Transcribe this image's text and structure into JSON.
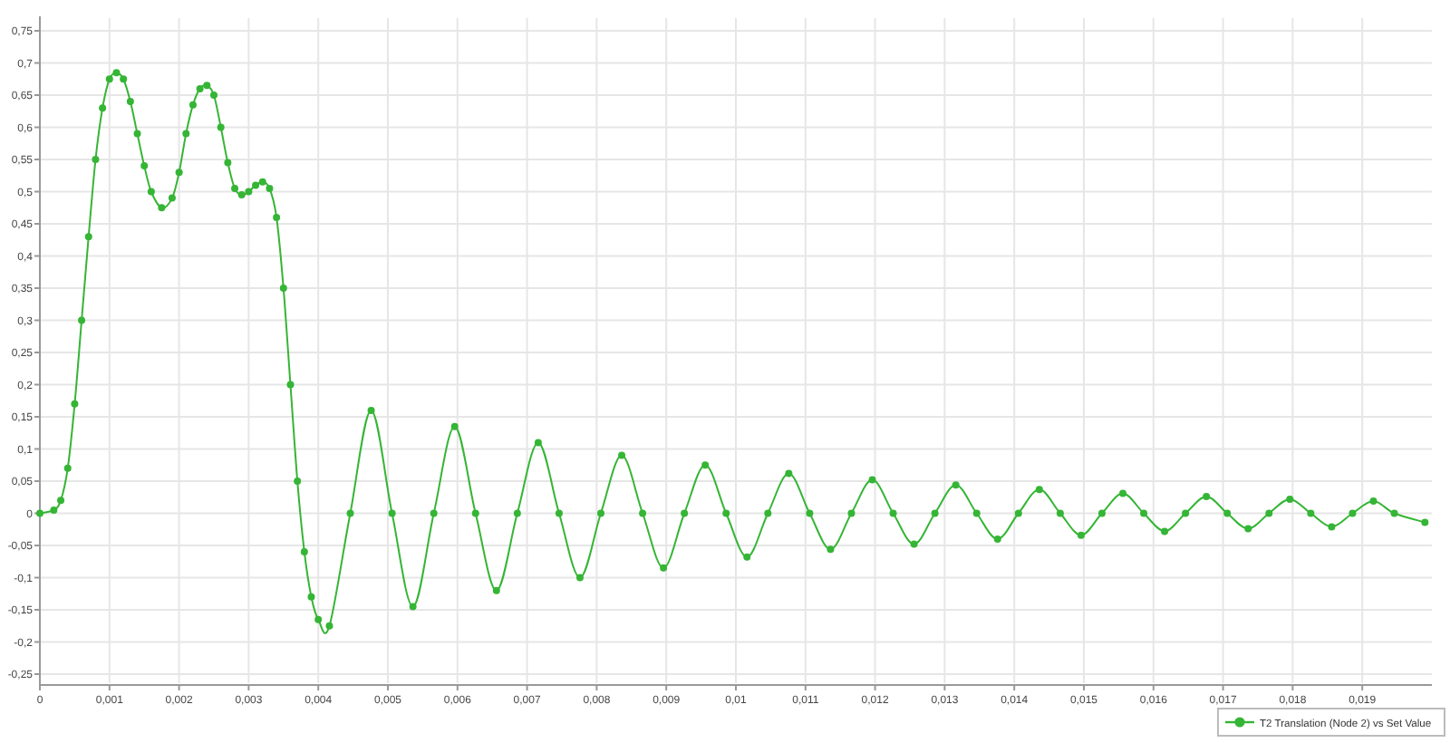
{
  "chart_data": {
    "type": "line",
    "grid": true,
    "xlim": [
      0,
      0.02
    ],
    "ylim": [
      -0.25,
      0.75
    ],
    "x": [
      0,
      0.0002,
      0.0003,
      0.0004,
      0.0005,
      0.0006,
      0.0007,
      0.0008,
      0.0009,
      0.001,
      0.0011,
      0.0012,
      0.0013,
      0.0014,
      0.0015,
      0.0016,
      0.00175,
      0.0019,
      0.002,
      0.0021,
      0.0022,
      0.0023,
      0.0024,
      0.0025,
      0.0026,
      0.0027,
      0.0028,
      0.0029,
      0.003,
      0.0031,
      0.0032,
      0.0033,
      0.0034,
      0.0035,
      0.0036,
      0.0037,
      0.0038,
      0.0039,
      0.004,
      0.00416,
      0.00446,
      0.00476,
      0.00506,
      0.00536,
      0.00566,
      0.00596,
      0.00626,
      0.00656,
      0.00686,
      0.00716,
      0.00746,
      0.00776,
      0.00806,
      0.00836,
      0.00866,
      0.00896,
      0.00926,
      0.00956,
      0.00986,
      0.01016,
      0.01046,
      0.01076,
      0.01106,
      0.01136,
      0.01166,
      0.01196,
      0.01226,
      0.01256,
      0.01286,
      0.01316,
      0.01346,
      0.01376,
      0.01406,
      0.01436,
      0.01466,
      0.01496,
      0.01526,
      0.01556,
      0.01586,
      0.01616,
      0.01646,
      0.01676,
      0.01706,
      0.01736,
      0.01766,
      0.01796,
      0.01826,
      0.01856,
      0.01886,
      0.01916,
      0.01946,
      0.0199
    ],
    "series": [
      {
        "name": "T2 Translation (Node 2) vs Set Value",
        "color": "#35b535",
        "marker": "circle",
        "values": [
          0,
          0.005,
          0.02,
          0.07,
          0.17,
          0.3,
          0.43,
          0.55,
          0.63,
          0.675,
          0.685,
          0.675,
          0.64,
          0.59,
          0.54,
          0.5,
          0.475,
          0.49,
          0.53,
          0.59,
          0.635,
          0.66,
          0.665,
          0.65,
          0.6,
          0.545,
          0.505,
          0.495,
          0.5,
          0.51,
          0.515,
          0.505,
          0.46,
          0.35,
          0.2,
          0.05,
          -0.06,
          -0.13,
          -0.165,
          -0.175,
          0,
          0.16,
          0,
          -0.145,
          0,
          0.135,
          0,
          -0.12,
          0,
          0.11,
          0,
          -0.1,
          0,
          0.09,
          0,
          -0.085,
          0,
          0.075,
          0,
          -0.068,
          0,
          0.062,
          0,
          -0.056,
          0,
          0.052,
          0,
          -0.048,
          0,
          0.044,
          0,
          -0.04,
          0,
          0.037,
          0,
          -0.034,
          0,
          0.031,
          0,
          -0.028,
          0,
          0.026,
          0,
          -0.024,
          0,
          0.022,
          0,
          -0.021,
          0,
          0.019,
          0,
          -0.014
        ]
      }
    ],
    "xticks": [
      {
        "value": 0,
        "label": "0"
      },
      {
        "value": 0.001,
        "label": "0,001"
      },
      {
        "value": 0.002,
        "label": "0,002"
      },
      {
        "value": 0.003,
        "label": "0,003"
      },
      {
        "value": 0.004,
        "label": "0,004"
      },
      {
        "value": 0.005,
        "label": "0,005"
      },
      {
        "value": 0.006,
        "label": "0,006"
      },
      {
        "value": 0.007,
        "label": "0,007"
      },
      {
        "value": 0.008,
        "label": "0,008"
      },
      {
        "value": 0.009,
        "label": "0,009"
      },
      {
        "value": 0.01,
        "label": "0,01"
      },
      {
        "value": 0.011,
        "label": "0,011"
      },
      {
        "value": 0.012,
        "label": "0,012"
      },
      {
        "value": 0.013,
        "label": "0,013"
      },
      {
        "value": 0.014,
        "label": "0,014"
      },
      {
        "value": 0.015,
        "label": "0,015"
      },
      {
        "value": 0.016,
        "label": "0,016"
      },
      {
        "value": 0.017,
        "label": "0,017"
      },
      {
        "value": 0.018,
        "label": "0,018"
      },
      {
        "value": 0.019,
        "label": "0,019"
      }
    ],
    "yticks": [
      {
        "value": 0.75,
        "label": "0,75"
      },
      {
        "value": 0.7,
        "label": "0,7"
      },
      {
        "value": 0.65,
        "label": "0,65"
      },
      {
        "value": 0.6,
        "label": "0,6"
      },
      {
        "value": 0.55,
        "label": "0,55"
      },
      {
        "value": 0.5,
        "label": "0,5"
      },
      {
        "value": 0.45,
        "label": "0,45"
      },
      {
        "value": 0.4,
        "label": "0,4"
      },
      {
        "value": 0.35,
        "label": "0,35"
      },
      {
        "value": 0.3,
        "label": "0,3"
      },
      {
        "value": 0.25,
        "label": "0,25"
      },
      {
        "value": 0.2,
        "label": "0,2"
      },
      {
        "value": 0.15,
        "label": "0,15"
      },
      {
        "value": 0.1,
        "label": "0,1"
      },
      {
        "value": 0.05,
        "label": "0,05"
      },
      {
        "value": 0,
        "label": "0"
      },
      {
        "value": -0.05,
        "label": "-0,05"
      },
      {
        "value": -0.1,
        "label": "-0,1"
      },
      {
        "value": -0.15,
        "label": "-0,15"
      },
      {
        "value": -0.2,
        "label": "-0,2"
      },
      {
        "value": -0.25,
        "label": "-0,25"
      }
    ]
  }
}
